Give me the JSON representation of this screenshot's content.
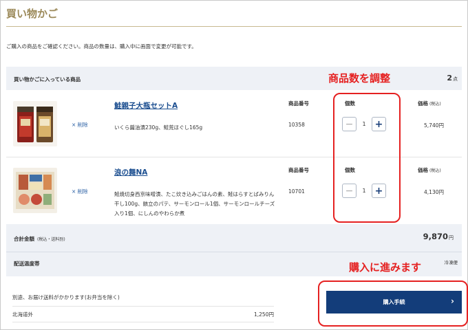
{
  "page": {
    "title": "買い物かご",
    "intro": "ご購入の商品をご確認ください。商品の数量は、購入中に画面で変更が可能です。"
  },
  "cart": {
    "header_label": "買い物かごに入っている商品",
    "count": "2",
    "count_unit": "点",
    "col_code": "商品番号",
    "col_qty": "個数",
    "col_price": "価格",
    "col_price_note": "(税込)",
    "delete_label": "× 削除",
    "items": [
      {
        "name": "鮭親子大瓶セットA",
        "desc": "いくら醤油漬230g、鮭荒ほぐし165g",
        "code": "10358",
        "qty": "1",
        "price": "5,740円"
      },
      {
        "name": "浪の舞NA",
        "desc": "鮭焼切身西京味噌漬、たこ炊き込みごはんの素、鮭はらすとばみりん干し100g、骸立のパテ、サーモンロール1個、サーモンロールチーズ入り1個、にしんのやわらか煮",
        "code": "10701",
        "qty": "1",
        "price": "4,130円"
      }
    ]
  },
  "summary": {
    "total_label": "合計金額",
    "total_note": "(税込・送料別)",
    "total_value": "9,870",
    "total_unit": "円",
    "delivery_label": "配送温度帯",
    "delivery_value": "冷凍便"
  },
  "shipping": {
    "note": "別途、お届け送料がかかります(お弁当を除く)",
    "region": "北海道外",
    "price": "1,250円"
  },
  "checkout": {
    "button_label": "購入手続"
  },
  "annotations": {
    "qty_callout": "商品数を調整",
    "buy_callout": "購入に進みます"
  },
  "colors": {
    "accent": "#133d7a",
    "gold": "#9c8a5a",
    "annotation": "#e52020"
  }
}
